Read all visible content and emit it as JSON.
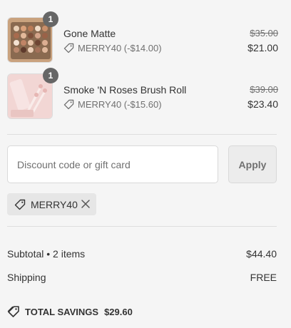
{
  "line_items": [
    {
      "quantity": "1",
      "name": "Gone Matte",
      "discount": "MERRY40 (-$14.00)",
      "original_price": "$35.00",
      "final_price": "$21.00",
      "thumbnail_icon": "eyeshadow-palette-thumbnail"
    },
    {
      "quantity": "1",
      "name": "Smoke 'N Roses Brush Roll",
      "discount": "MERRY40 (-$15.60)",
      "original_price": "$39.00",
      "final_price": "$23.40",
      "thumbnail_icon": "brush-roll-thumbnail"
    }
  ],
  "discount": {
    "placeholder": "Discount code or gift card",
    "apply_label": "Apply",
    "applied_code": "MERRY40"
  },
  "summary": {
    "subtotal_label": "Subtotal • 2 items",
    "subtotal_value": "$44.40",
    "shipping_label": "Shipping",
    "shipping_value": "FREE",
    "savings_label": "TOTAL SAVINGS",
    "savings_value": "$29.60"
  },
  "colors": {
    "background": "#f5f5f5",
    "badge": "#666666",
    "muted_text": "#707070",
    "text": "#333333",
    "chip": "#e6e6e6"
  }
}
